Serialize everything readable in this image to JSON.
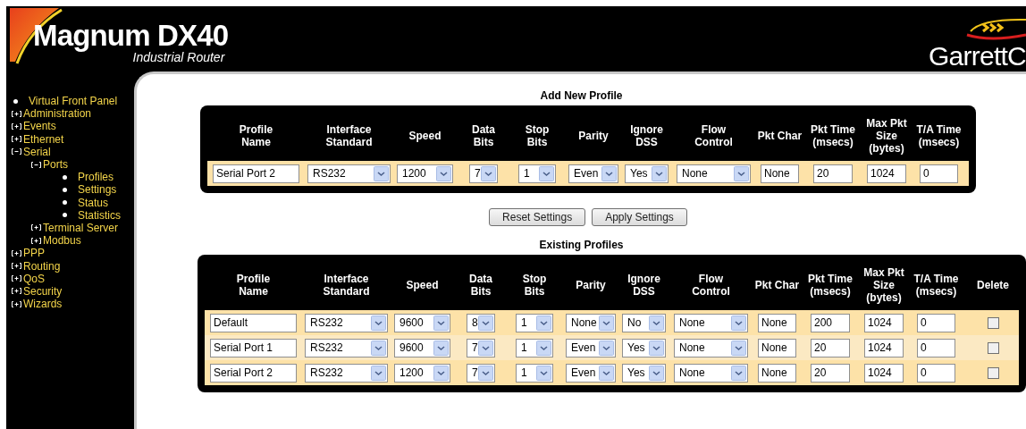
{
  "header": {
    "product": "Magnum DX40",
    "subtitle": "Industrial Router",
    "brand": "GarrettC"
  },
  "sidebar": {
    "items": [
      {
        "label": "Virtual Front Panel",
        "kind": "page"
      },
      {
        "label": "Administration",
        "kind": "folder",
        "expanded": false
      },
      {
        "label": "Events",
        "kind": "folder",
        "expanded": false
      },
      {
        "label": "Ethernet",
        "kind": "folder",
        "expanded": false
      },
      {
        "label": "Serial",
        "kind": "folder",
        "expanded": true,
        "children": [
          {
            "label": "Ports",
            "kind": "folder",
            "expanded": true,
            "children": [
              {
                "label": "Profiles",
                "kind": "page"
              },
              {
                "label": "Settings",
                "kind": "page"
              },
              {
                "label": "Status",
                "kind": "page"
              },
              {
                "label": "Statistics",
                "kind": "page"
              }
            ]
          },
          {
            "label": "Terminal Server",
            "kind": "folder",
            "expanded": false
          },
          {
            "label": "Modbus",
            "kind": "folder",
            "expanded": false
          }
        ]
      },
      {
        "label": "PPP",
        "kind": "folder",
        "expanded": false
      },
      {
        "label": "Routing",
        "kind": "folder",
        "expanded": false
      },
      {
        "label": "QoS",
        "kind": "folder",
        "expanded": false
      },
      {
        "label": "Security",
        "kind": "folder",
        "expanded": false
      },
      {
        "label": "Wizards",
        "kind": "folder",
        "expanded": false
      }
    ]
  },
  "add_profile": {
    "title": "Add New Profile",
    "columns": [
      {
        "label": "Profile\nName",
        "kind": "text"
      },
      {
        "label": "Interface\nStandard",
        "kind": "select"
      },
      {
        "label": "Speed",
        "kind": "select"
      },
      {
        "label": "Data\nBits",
        "kind": "select"
      },
      {
        "label": "Stop\nBits",
        "kind": "select"
      },
      {
        "label": "Parity",
        "kind": "select"
      },
      {
        "label": "Ignore\nDSS",
        "kind": "select"
      },
      {
        "label": "Flow\nControl",
        "kind": "select"
      },
      {
        "label": "Pkt Char",
        "kind": "text"
      },
      {
        "label": "Pkt Time\n(msecs)",
        "kind": "text"
      },
      {
        "label": "Max Pkt\nSize\n(bytes)",
        "kind": "text"
      },
      {
        "label": "T/A Time\n(msecs)",
        "kind": "text"
      }
    ],
    "rows": [
      {
        "values": [
          "Serial Port 2",
          "RS232",
          "1200",
          "7",
          "1",
          "Even",
          "Yes",
          "None",
          "None",
          "20",
          "1024",
          "0"
        ]
      }
    ]
  },
  "buttons": [
    "Reset Settings",
    "Apply Settings"
  ],
  "existing_profiles": {
    "title": "Existing Profiles",
    "columns": [
      {
        "label": "Profile\nName",
        "kind": "text"
      },
      {
        "label": "Interface\nStandard",
        "kind": "select"
      },
      {
        "label": "Speed",
        "kind": "select"
      },
      {
        "label": "Data\nBits",
        "kind": "select"
      },
      {
        "label": "Stop\nBits",
        "kind": "select"
      },
      {
        "label": "Parity",
        "kind": "select"
      },
      {
        "label": "Ignore\nDSS",
        "kind": "select"
      },
      {
        "label": "Flow\nControl",
        "kind": "select"
      },
      {
        "label": "Pkt Char",
        "kind": "text"
      },
      {
        "label": "Pkt Time\n(msecs)",
        "kind": "text"
      },
      {
        "label": "Max Pkt\nSize\n(bytes)",
        "kind": "text"
      },
      {
        "label": "T/A Time\n(msecs)",
        "kind": "text"
      },
      {
        "label": "Delete",
        "kind": "checkbox"
      }
    ],
    "rows": [
      {
        "values": [
          "Default",
          "RS232",
          "9600",
          "8",
          "1",
          "None",
          "No",
          "None",
          "None",
          "200",
          "1024",
          "0"
        ],
        "delete": false
      },
      {
        "values": [
          "Serial Port 1",
          "RS232",
          "9600",
          "7",
          "1",
          "Even",
          "Yes",
          "None",
          "None",
          "20",
          "1024",
          "0"
        ],
        "delete": false
      },
      {
        "values": [
          "Serial Port 2",
          "RS232",
          "1200",
          "7",
          "1",
          "Even",
          "Yes",
          "None",
          "None",
          "20",
          "1024",
          "0"
        ],
        "delete": false
      }
    ]
  }
}
